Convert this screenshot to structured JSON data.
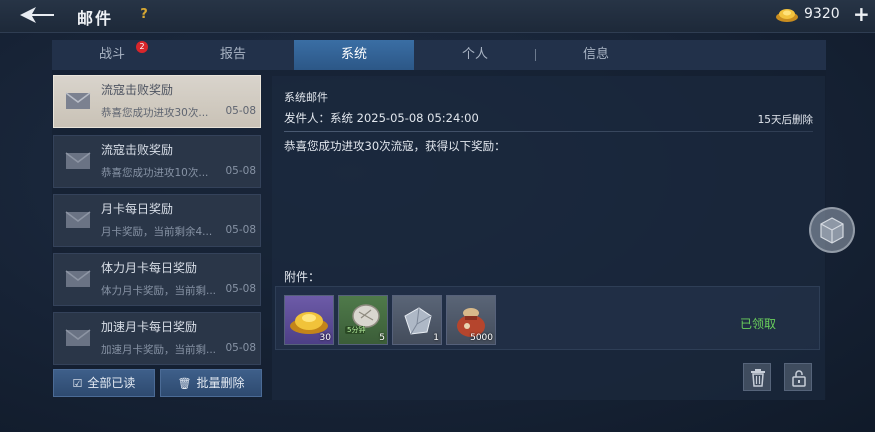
{
  "header": {
    "title": "邮件",
    "help_label": "?",
    "currency_amount": "9320",
    "add_label": "+"
  },
  "tabs": [
    {
      "label": "战斗",
      "badge": "2"
    },
    {
      "label": "报告"
    },
    {
      "label": "系统",
      "active": true
    },
    {
      "label": "个人"
    },
    {
      "label": "信息"
    }
  ],
  "mails": [
    {
      "title": "流寇击败奖励",
      "preview": "恭喜您成功进攻30次...",
      "date": "05-08",
      "selected": true
    },
    {
      "title": "流寇击败奖励",
      "preview": "恭喜您成功进攻10次...",
      "date": "05-08"
    },
    {
      "title": "月卡每日奖励",
      "preview": "月卡奖励，当前剩余4...",
      "date": "05-08"
    },
    {
      "title": "体力月卡每日奖励",
      "preview": "体力月卡奖励，当前剩...",
      "date": "05-08"
    },
    {
      "title": "加速月卡每日奖励",
      "preview": "加速月卡奖励，当前剩...",
      "date": "05-08"
    }
  ],
  "list_actions": {
    "read_all": "全部已读",
    "batch_delete": "批量删除"
  },
  "detail": {
    "sender_title": "系统邮件",
    "from_line": "发件人：系统   2025-05-08 05:24:00",
    "expire": "15天后删除",
    "body": "恭喜您成功进攻30次流寇，获得以下奖励：",
    "attachments_label": "附件：",
    "attachments": [
      {
        "name": "gold-ingot",
        "qty": "30"
      },
      {
        "name": "speedup-5min",
        "qty": "5",
        "tag": "5分钟"
      },
      {
        "name": "iron-ore",
        "qty": "1"
      },
      {
        "name": "food-sack",
        "qty": "5000"
      }
    ],
    "status": "已领取"
  },
  "colors": {
    "accent": "#2c5787",
    "claimed": "#6ad05c",
    "badge": "#d8262b",
    "gold": "#d6a732"
  }
}
